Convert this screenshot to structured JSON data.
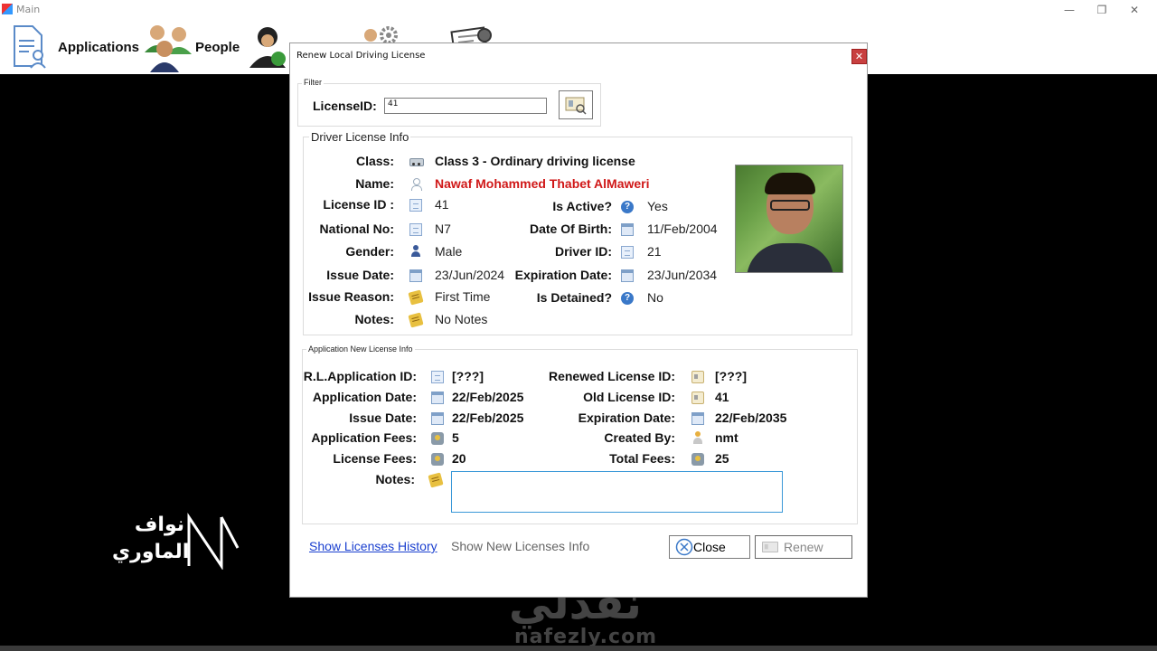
{
  "main_window": {
    "title": "Main",
    "controls": {
      "minimize": "—",
      "maximize": "❐",
      "close": "✕"
    }
  },
  "toolbar": {
    "items": [
      {
        "label": "Applications",
        "icon": "applications-document-icon"
      },
      {
        "label": "People",
        "icon": "people-group-icon"
      },
      {
        "label": "",
        "icon": "drivers-icon"
      },
      {
        "label": "",
        "icon": "users-settings-icon"
      },
      {
        "label": "",
        "icon": "account-settings-icon"
      }
    ]
  },
  "dialog": {
    "title": "Renew Local Driving License",
    "close_glyph": "✕",
    "filter": {
      "title": "Filter",
      "license_id_label": "LicenseID:",
      "license_id_value": "41"
    },
    "driver_license_info": {
      "title": "Driver License Info",
      "class_label": "Class:",
      "class_value": "Class 3 - Ordinary driving license",
      "name_label": "Name:",
      "name_value": "Nawaf Mohammed Thabet AlMaweri",
      "license_id_label": "License ID :",
      "license_id_value": "41",
      "is_active_label": "Is Active?",
      "is_active_value": "Yes",
      "national_no_label": "National No:",
      "national_no_value": "N7",
      "dob_label": "Date Of Birth:",
      "dob_value": "11/Feb/2004",
      "gender_label": "Gender:",
      "gender_value": "Male",
      "driver_id_label": "Driver ID:",
      "driver_id_value": "21",
      "issue_date_label": "Issue Date:",
      "issue_date_value": "23/Jun/2024",
      "expiration_date_label": "Expiration Date:",
      "expiration_date_value": "23/Jun/2034",
      "issue_reason_label": "Issue Reason:",
      "issue_reason_value": "First Time",
      "is_detained_label": "Is Detained?",
      "is_detained_value": "No",
      "notes_label": "Notes:",
      "notes_value": "No Notes"
    },
    "application_info": {
      "title": "Application New License Info",
      "rl_app_id_label": "R.L.Application ID:",
      "rl_app_id_value": "[???]",
      "renewed_license_id_label": "Renewed License ID:",
      "renewed_license_id_value": "[???]",
      "application_date_label": "Application Date:",
      "application_date_value": "22/Feb/2025",
      "old_license_id_label": "Old License ID:",
      "old_license_id_value": "41",
      "issue_date_label": "Issue Date:",
      "issue_date_value": "22/Feb/2025",
      "expiration_date_label": "Expiration Date:",
      "expiration_date_value": "22/Feb/2035",
      "application_fees_label": "Application Fees:",
      "application_fees_value": "5",
      "created_by_label": "Created By:",
      "created_by_value": "nmt",
      "license_fees_label": "License  Fees:",
      "license_fees_value": "20",
      "total_fees_label": "Total  Fees:",
      "total_fees_value": "25",
      "notes_label": "Notes:",
      "notes_value": ""
    },
    "footer": {
      "show_history": "Show Licenses History",
      "show_new_info": "Show New Licenses Info",
      "close": "Close",
      "renew": "Renew"
    }
  },
  "watermark": {
    "arabic": "نفذلي",
    "site": "nafezly.com"
  },
  "author_logo": {
    "line1": "نواف",
    "line2": "الماوري",
    "mark": "N"
  },
  "colors": {
    "name_red": "#d01818",
    "link_blue": "#1a3fcf",
    "focus_blue": "#3a98d8"
  }
}
